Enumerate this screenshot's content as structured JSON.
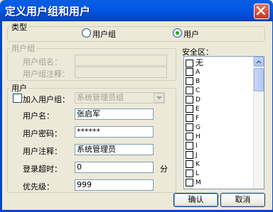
{
  "window": {
    "title": "定义用户组和用户"
  },
  "type_group": {
    "legend": "类型",
    "options": [
      {
        "label": "用户组",
        "selected": false
      },
      {
        "label": "用户",
        "selected": true
      }
    ]
  },
  "usergroup_group": {
    "legend": "用户组",
    "name_label": "用户组名：",
    "comment_label": "用户组注释：",
    "name_value": "",
    "comment_value": ""
  },
  "user_group": {
    "legend": "用户",
    "join_label": "加入用户组：",
    "join_checked": false,
    "join_select_value": "系统管理员组",
    "name_label": "用户名：",
    "name_value": "张启军",
    "password_label": "用户密码：",
    "password_value": "******",
    "comment_label": "用户注释：",
    "comment_value": "系统管理员",
    "timeout_label": "登录超时：",
    "timeout_value": "0",
    "timeout_unit": "分",
    "priority_label": "优先级：",
    "priority_value": "999"
  },
  "security": {
    "label": "安全区：",
    "items": [
      "无",
      "A",
      "B",
      "C",
      "D",
      "E",
      "F",
      "G",
      "H",
      "I",
      "J",
      "K",
      "L",
      "M"
    ]
  },
  "buttons": {
    "ok": "确认",
    "cancel": "取消"
  },
  "colors": {
    "title_bar": "#0058e6",
    "dialog_bg": "#ece9d8",
    "close_button": "#c4381b"
  }
}
